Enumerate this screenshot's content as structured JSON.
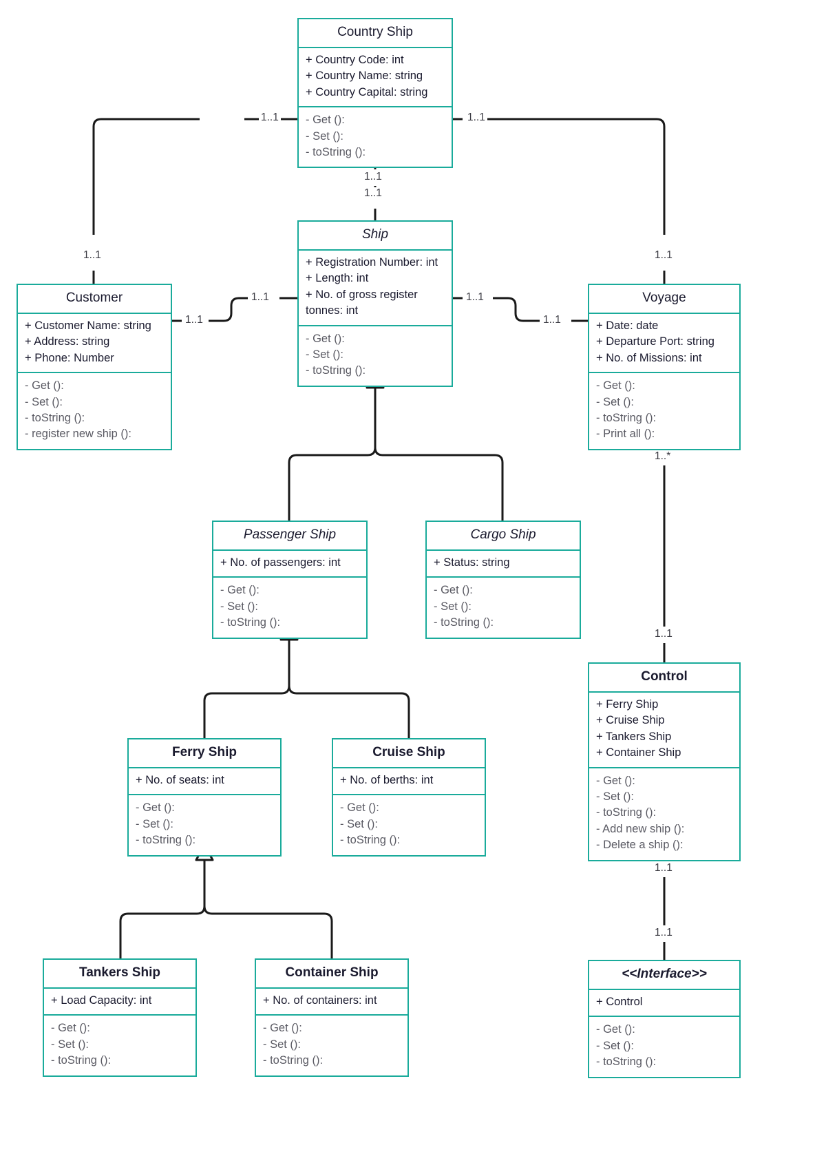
{
  "diagram": {
    "title": "Ship Management UML Class Diagram",
    "accent_color": "#1aab9b",
    "line_color": "#1a1a1a",
    "text_color": "#1a1a2e",
    "method_color": "#5a5a63"
  },
  "classes": {
    "country_ship": {
      "name": "Country Ship",
      "attributes": [
        "+ Country Code: int",
        "+ Country Name: string",
        "+ Country Capital: string"
      ],
      "operations": [
        "- Get ():",
        "- Set ():",
        "- toString ():"
      ]
    },
    "ship": {
      "name": "Ship",
      "attributes": [
        "+ Registration Number: int",
        "+ Length: int",
        "+ No. of gross register tonnes: int"
      ],
      "operations": [
        "- Get ():",
        "- Set ():",
        "- toString ():"
      ]
    },
    "customer": {
      "name": "Customer",
      "attributes": [
        "+ Customer Name: string",
        "+ Address: string",
        "+ Phone: Number"
      ],
      "operations": [
        "- Get ():",
        "- Set ():",
        "- toString ():",
        "- register new ship ():"
      ]
    },
    "voyage": {
      "name": "Voyage",
      "attributes": [
        "+ Date: date",
        "+ Departure Port: string",
        "+ No. of Missions: int"
      ],
      "operations": [
        "- Get ():",
        "- Set ():",
        "- toString ():",
        "- Print all ():"
      ]
    },
    "passenger_ship": {
      "name": "Passenger Ship",
      "attributes": [
        "+ No. of passengers: int"
      ],
      "operations": [
        "- Get ():",
        "- Set ():",
        "- toString ():"
      ]
    },
    "cargo_ship": {
      "name": "Cargo Ship",
      "attributes": [
        "+ Status: string"
      ],
      "operations": [
        "- Get ():",
        "- Set ():",
        "- toString ():"
      ]
    },
    "ferry_ship": {
      "name": "Ferry Ship",
      "attributes": [
        "+ No. of seats: int"
      ],
      "operations": [
        "- Get ():",
        "- Set ():",
        "- toString ():"
      ]
    },
    "cruise_ship": {
      "name": "Cruise Ship",
      "attributes": [
        "+ No. of berths: int"
      ],
      "operations": [
        "- Get ():",
        "- Set ():",
        "- toString ():"
      ]
    },
    "tankers_ship": {
      "name": "Tankers  Ship",
      "attributes": [
        "+ Load Capacity: int"
      ],
      "operations": [
        "- Get ():",
        "- Set ():",
        "- toString ():"
      ]
    },
    "container_ship": {
      "name": "Container Ship",
      "attributes": [
        "+ No. of containers: int"
      ],
      "operations": [
        "- Get ():",
        "- Set ():",
        "- toString ():"
      ]
    },
    "control": {
      "name": "Control",
      "attributes": [
        "+ Ferry Ship",
        "+ Cruise Ship",
        "+ Tankers  Ship",
        "+ Container Ship"
      ],
      "operations": [
        "- Get ():",
        "- Set ():",
        "- toString ():",
        "- Add new ship ():",
        "- Delete a ship ():"
      ]
    },
    "interface": {
      "name": "<<Interface>>",
      "attributes": [
        "+ Control"
      ],
      "operations": [
        "- Get ():",
        "- Set ():",
        "- toString ():"
      ]
    }
  },
  "multiplicities": {
    "country_to_customer": "1..1",
    "customer_end": "1..1",
    "country_to_voyage": "1..1",
    "voyage_end": "1..1",
    "country_to_ship_top": "1..1",
    "country_to_ship_bottom": "1..1",
    "customer_to_ship_left": "1..1",
    "customer_to_ship_right": "1..1",
    "ship_to_voyage_left": "1..1",
    "ship_to_voyage_right": "1..1",
    "voyage_to_control_top": "1..*",
    "voyage_to_control_bottom": "1..1",
    "control_to_interface_top": "1..1",
    "control_to_interface_bottom": "1..1"
  }
}
